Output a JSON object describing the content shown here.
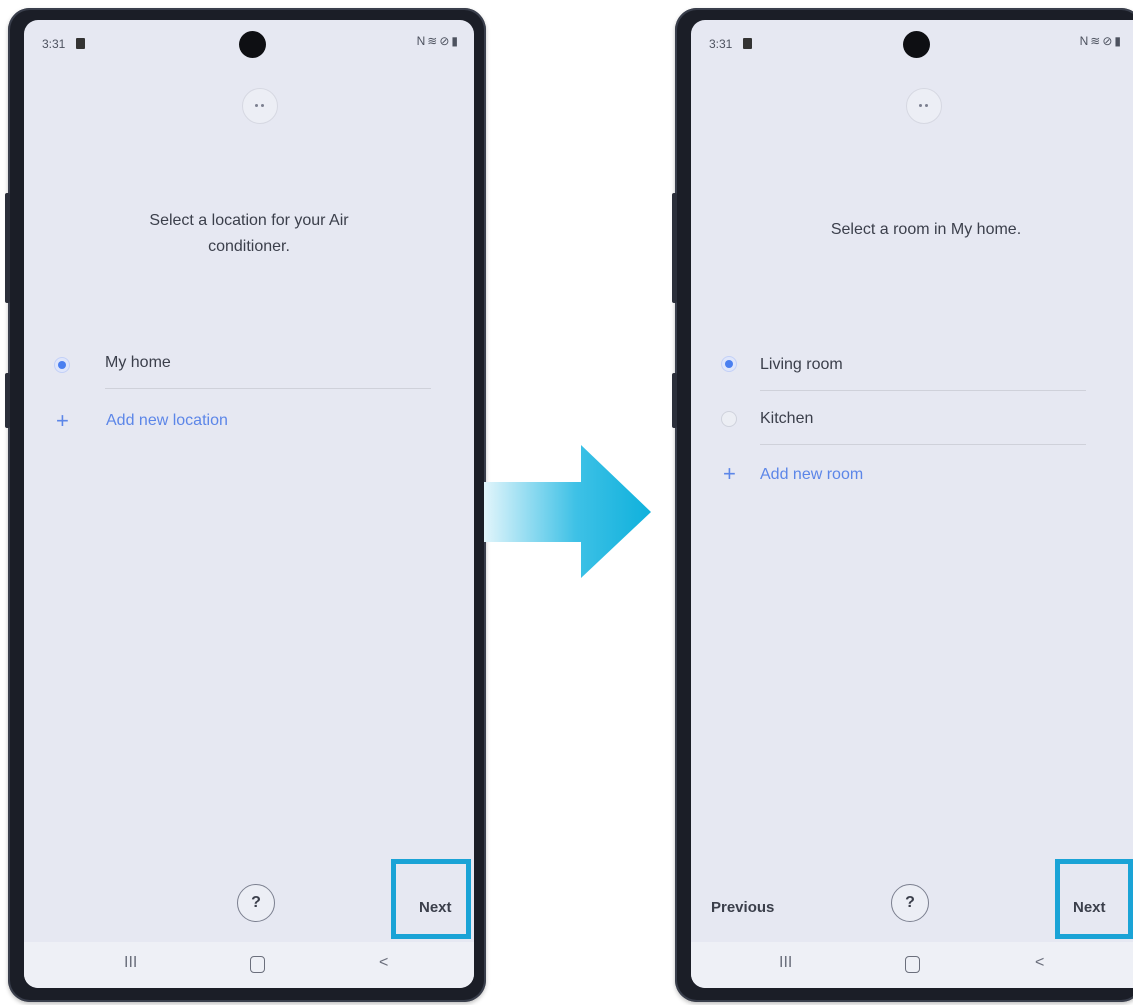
{
  "colors": {
    "accent_blue": "#4a7ff0",
    "highlight_cyan": "#1aa3d6",
    "arrow_cyan": "#0fb1dc",
    "screen_bg": "#e6e8f2"
  },
  "left_screen": {
    "status": {
      "time": "3:31",
      "icons": [
        "nfc-icon",
        "wifi-icon",
        "dnd-icon",
        "battery-icon"
      ]
    },
    "prompt_line1": "Select a location for your Air",
    "prompt_line2": "conditioner.",
    "options": [
      {
        "label": "My home",
        "selected": true
      }
    ],
    "add_label": "Add new location",
    "help_label": "?",
    "next_label": "Next",
    "navbar": {
      "recent": "III",
      "back": "<"
    }
  },
  "right_screen": {
    "status": {
      "time": "3:31",
      "icons": [
        "nfc-icon",
        "wifi-icon",
        "dnd-icon",
        "battery-icon"
      ]
    },
    "prompt": "Select a room in My home.",
    "options": [
      {
        "label": "Living room",
        "selected": true
      },
      {
        "label": "Kitchen",
        "selected": false
      }
    ],
    "add_label": "Add new room",
    "previous_label": "Previous",
    "help_label": "?",
    "next_label": "Next",
    "navbar": {
      "recent": "III",
      "back": "<"
    }
  }
}
